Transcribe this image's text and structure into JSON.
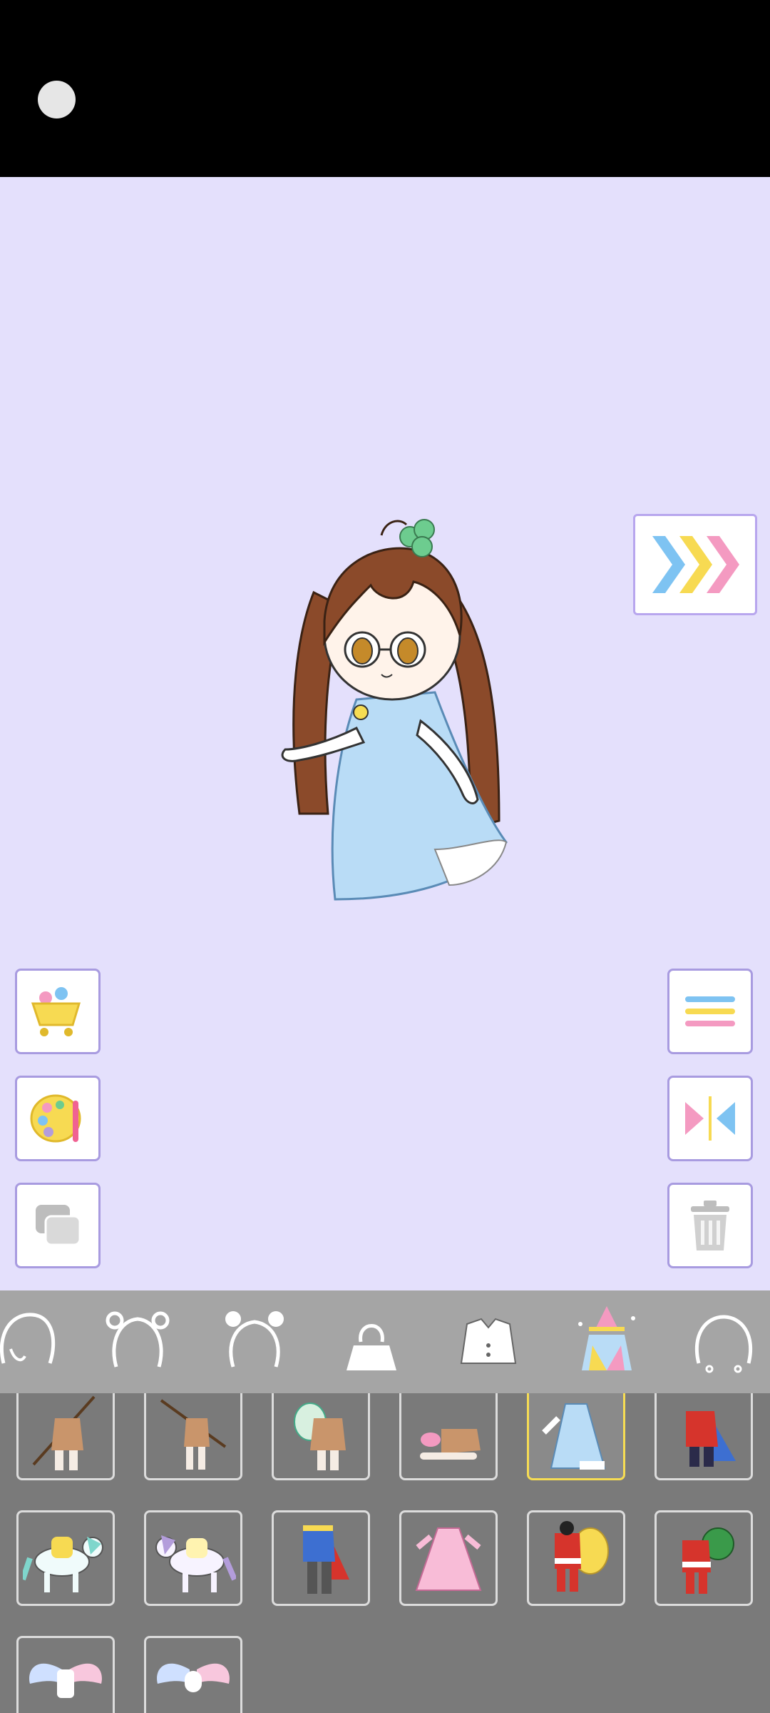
{
  "app": {
    "title": ""
  },
  "colors": {
    "stage_bg": "#e4e0fc",
    "panel_bg": "#7a7a7a",
    "tabbar_bg": "#a5a5a5",
    "selected_border": "#f6dc53",
    "button_border": "#a89be0"
  },
  "stage": {
    "next_button": {
      "icon": "triple-chevron-right-icon"
    },
    "left_buttons": [
      {
        "name": "shop-button",
        "icon": "shopping-cart-icon"
      },
      {
        "name": "palette-button",
        "icon": "paint-palette-icon"
      },
      {
        "name": "layers-button",
        "icon": "layers-icon"
      }
    ],
    "right_buttons": [
      {
        "name": "menu-button",
        "icon": "hamburger-menu-icon"
      },
      {
        "name": "flip-button",
        "icon": "mirror-flip-icon"
      },
      {
        "name": "delete-button",
        "icon": "trash-can-icon"
      }
    ]
  },
  "category_tabs": [
    {
      "name": "tab-hair-back",
      "icon": "hair-back-icon",
      "selected": false
    },
    {
      "name": "tab-hair-pigtails",
      "icon": "hair-pigtails-icon",
      "selected": false
    },
    {
      "name": "tab-hair-buns",
      "icon": "hair-buns-icon",
      "selected": false
    },
    {
      "name": "tab-hoodie",
      "icon": "hoodie-icon",
      "selected": false
    },
    {
      "name": "tab-jacket",
      "icon": "jacket-icon",
      "selected": false
    },
    {
      "name": "tab-costume-set",
      "icon": "costume-set-icon",
      "selected": true
    },
    {
      "name": "tab-head-accessory",
      "icon": "head-outline-icon",
      "selected": false
    }
  ],
  "items": [
    {
      "name": "item-spear-caveman",
      "icon": "spear-caveman-icon",
      "selected": false
    },
    {
      "name": "item-spear-hunter",
      "icon": "spear-hunter-icon",
      "selected": false
    },
    {
      "name": "item-egg-costume",
      "icon": "egg-costume-icon",
      "selected": false
    },
    {
      "name": "item-lying-outfit",
      "icon": "lying-outfit-icon",
      "selected": false
    },
    {
      "name": "item-blue-princess-dress",
      "icon": "blue-dress-icon",
      "selected": true
    },
    {
      "name": "item-red-soldier",
      "icon": "red-soldier-icon",
      "selected": false
    },
    {
      "name": "item-teal-horse",
      "icon": "teal-horse-icon",
      "selected": false
    },
    {
      "name": "item-purple-horse",
      "icon": "purple-horse-icon",
      "selected": false
    },
    {
      "name": "item-prince-outfit",
      "icon": "prince-outfit-icon",
      "selected": false
    },
    {
      "name": "item-pink-dress",
      "icon": "pink-dress-icon",
      "selected": false
    },
    {
      "name": "item-santa-sack",
      "icon": "santa-sack-icon",
      "selected": false
    },
    {
      "name": "item-santa-green-sack",
      "icon": "santa-green-sack-icon",
      "selected": false
    },
    {
      "name": "item-angel-wings-blue",
      "icon": "angel-wings-icon",
      "selected": false
    },
    {
      "name": "item-angel-wings-pink",
      "icon": "angel-wings-pink-icon",
      "selected": false
    }
  ]
}
